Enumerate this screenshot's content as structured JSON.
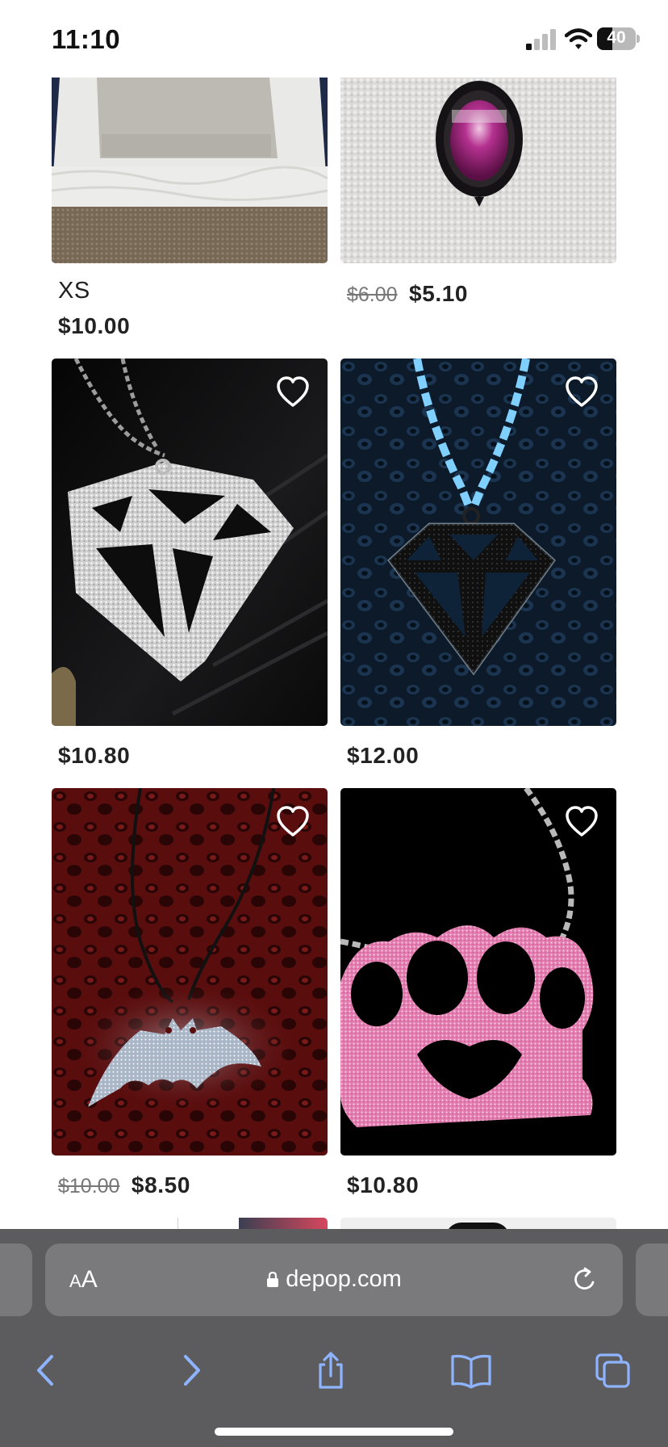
{
  "status_bar": {
    "time": "11:10",
    "battery_level": "40",
    "battery_fraction": 0.4
  },
  "products": [
    {
      "size": "XS",
      "original_price": "",
      "price": "$10.00",
      "liked": false,
      "image": "grey-tank-top-on-bed"
    },
    {
      "size": "",
      "original_price": "$6.00",
      "price": "$5.10",
      "liked": false,
      "image": "oval-purple-cameo-pendant"
    },
    {
      "size": "",
      "original_price": "",
      "price": "$10.80",
      "liked": false,
      "image": "silver-glitter-diamond-necklace"
    },
    {
      "size": "",
      "original_price": "",
      "price": "$12.00",
      "liked": false,
      "image": "black-glitter-diamond-necklace"
    },
    {
      "size": "",
      "original_price": "$10.00",
      "price": "$8.50",
      "liked": false,
      "image": "silver-glitter-bat-necklace"
    },
    {
      "size": "",
      "original_price": "",
      "price": "$10.80",
      "liked": false,
      "image": "pink-glitter-knuckle-necklace"
    }
  ],
  "browser": {
    "text_size_small": "A",
    "text_size_big": "A",
    "url": "depop.com"
  },
  "icons": {
    "like": "heart-outline-icon",
    "lock": "lock-icon",
    "reload": "reload-icon",
    "back": "chevron-left-icon",
    "forward": "chevron-right-icon",
    "share": "share-icon",
    "bookmarks": "book-icon",
    "tabs": "tabs-icon"
  },
  "colors": {
    "toolbar_background": "#5c5c5e",
    "toolbar_icon": "#8fb4ff",
    "price_text": "#222222",
    "strikethrough_text": "#777777"
  }
}
